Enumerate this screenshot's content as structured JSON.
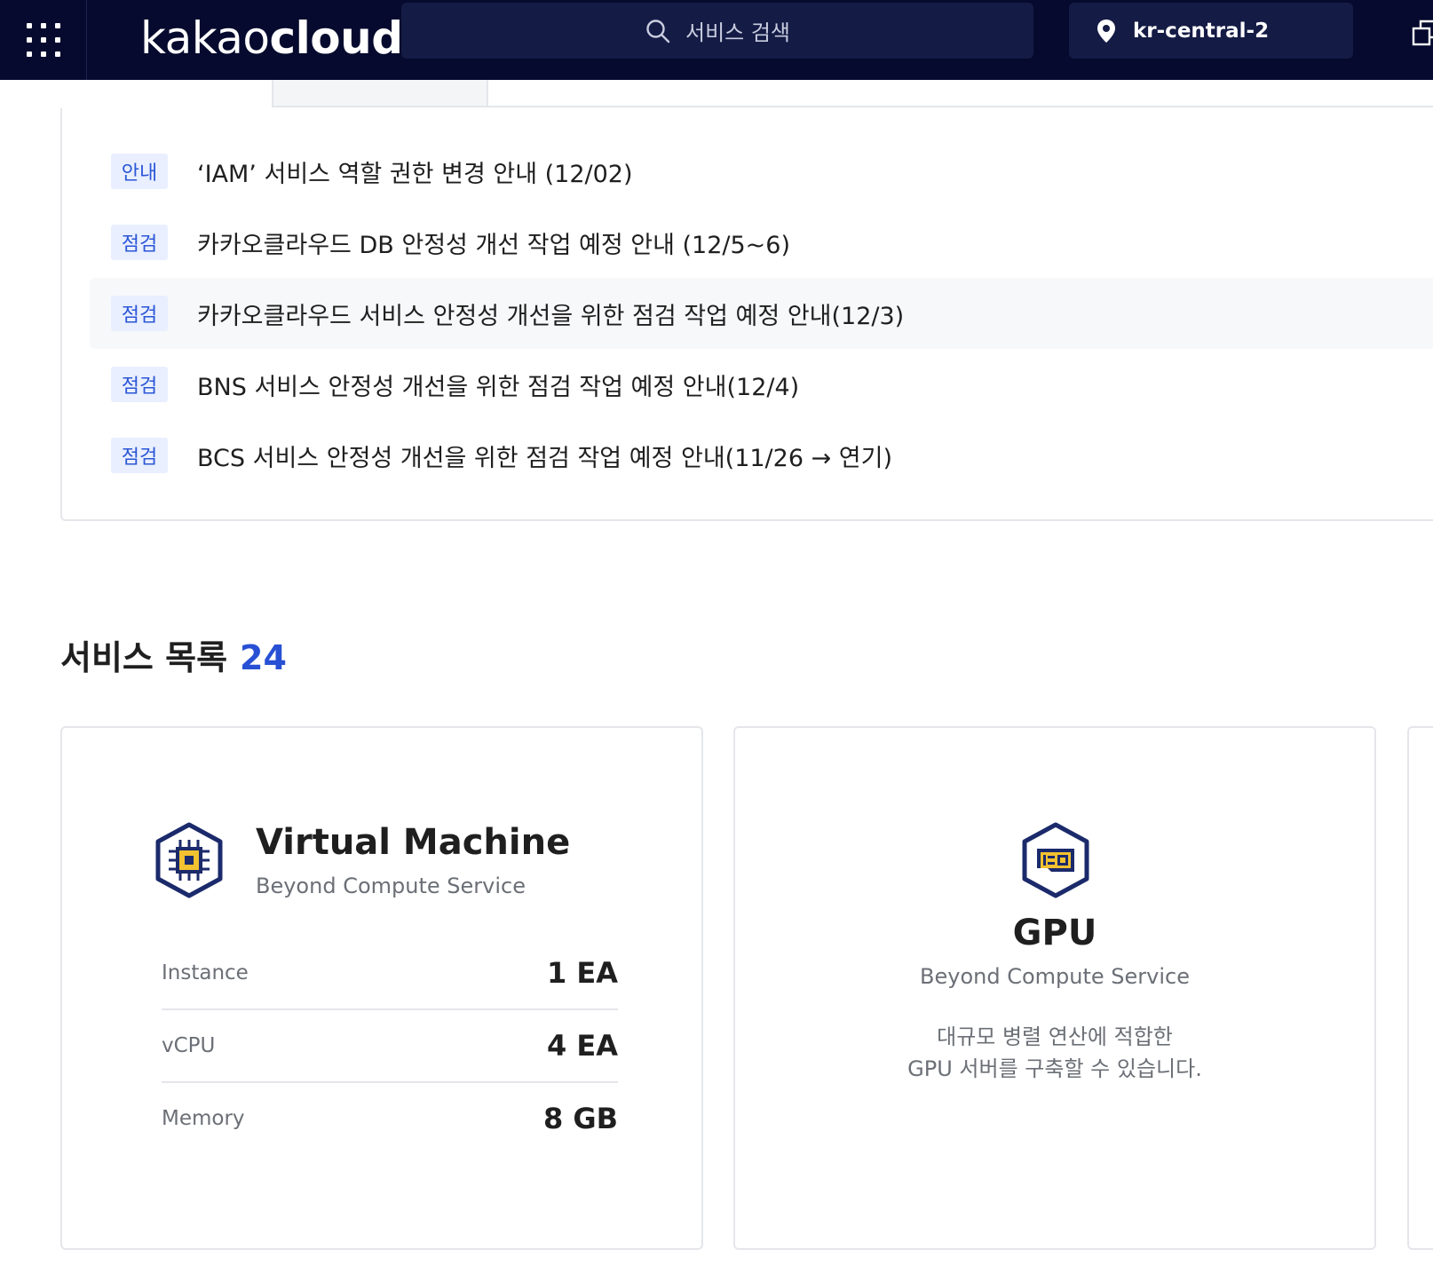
{
  "header": {
    "logo_light": "kakao",
    "logo_bold": "cloud",
    "search_placeholder": "서비스 검색",
    "region": "kr-central-2"
  },
  "notices": [
    {
      "badge": "안내",
      "text": "‘IAM’ 서비스 역할 권한 변경 안내 (12/02)"
    },
    {
      "badge": "점검",
      "text": "카카오클라우드 DB 안정성 개선 작업 예정 안내 (12/5~6)"
    },
    {
      "badge": "점검",
      "text": "카카오클라우드 서비스 안정성 개선을 위한 점검 작업 예정 안내(12/3)"
    },
    {
      "badge": "점검",
      "text": "BNS 서비스 안정성 개선을 위한 점검 작업 예정 안내(12/4)"
    },
    {
      "badge": "점검",
      "text": "BCS 서비스 안정성 개선을 위한 점검 작업 예정 안내(11/26 → 연기)"
    }
  ],
  "services": {
    "title": "서비스 목록",
    "count": "24",
    "vm": {
      "name": "Virtual Machine",
      "category": "Beyond Compute Service",
      "specs": [
        {
          "label": "Instance",
          "value": "1 EA"
        },
        {
          "label": "vCPU",
          "value": "4 EA"
        },
        {
          "label": "Memory",
          "value": "8 GB"
        }
      ]
    },
    "gpu": {
      "name": "GPU",
      "category": "Beyond Compute Service",
      "desc_line1": "대규모 병렬 연산에 적합한",
      "desc_line2": "GPU 서버를 구축할 수 있습니다."
    }
  },
  "colors": {
    "topbar": "#050a2e",
    "search_bg": "#141b45",
    "accent_blue": "#2850d4",
    "badge_bg": "#e9efff",
    "icon_navy": "#1b2a6b",
    "icon_yellow": "#f2c230"
  }
}
